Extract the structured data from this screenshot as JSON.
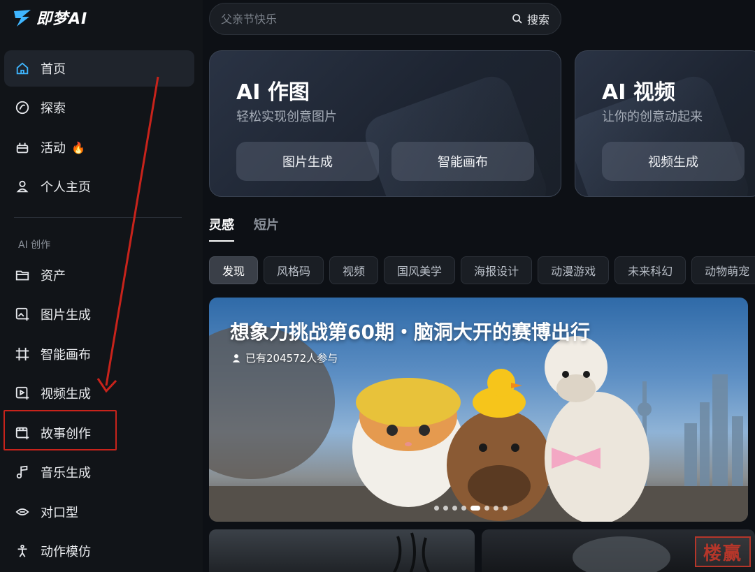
{
  "app": {
    "logo_text": "即梦AI"
  },
  "sidebar": {
    "main_items": [
      {
        "label": "首页",
        "icon": "home-icon",
        "active": true
      },
      {
        "label": "探索",
        "icon": "compass-icon"
      },
      {
        "label": "活动",
        "icon": "gift-icon",
        "badge_icon": "fire-icon"
      },
      {
        "label": "个人主页",
        "icon": "user-icon"
      }
    ],
    "section_title": "AI 创作",
    "creation_items": [
      {
        "label": "资产",
        "icon": "folder-icon"
      },
      {
        "label": "图片生成",
        "icon": "image-gen-icon"
      },
      {
        "label": "智能画布",
        "icon": "canvas-icon"
      },
      {
        "label": "视频生成",
        "icon": "video-gen-icon"
      },
      {
        "label": "故事创作",
        "icon": "story-icon",
        "highlighted": true
      },
      {
        "label": "音乐生成",
        "icon": "music-icon"
      },
      {
        "label": "对口型",
        "icon": "lip-sync-icon"
      },
      {
        "label": "动作模仿",
        "icon": "motion-icon"
      }
    ]
  },
  "search": {
    "placeholder": "父亲节快乐",
    "button_label": "搜索"
  },
  "cards": [
    {
      "title": "AI 作图",
      "subtitle": "轻松实现创意图片",
      "buttons": [
        "图片生成",
        "智能画布"
      ]
    },
    {
      "title": "AI 视频",
      "subtitle": "让你的创意动起来",
      "buttons": [
        "视频生成"
      ]
    }
  ],
  "tabs": [
    {
      "label": "灵感",
      "active": true
    },
    {
      "label": "短片",
      "active": false
    }
  ],
  "chips": [
    "发现",
    "风格码",
    "视频",
    "国风美学",
    "海报设计",
    "动漫游戏",
    "未来科幻",
    "动物萌宠"
  ],
  "banner": {
    "title": "想象力挑战第60期・脑洞大开的赛博出行",
    "participants": "已有204572人参与",
    "slide_count": 8,
    "active_slide": 4
  },
  "watermark": {
    "stamp_text": "楼赢"
  },
  "colors": {
    "highlight": "#c8231b",
    "background": "#0d1015",
    "fire": "#ff8a2a"
  }
}
